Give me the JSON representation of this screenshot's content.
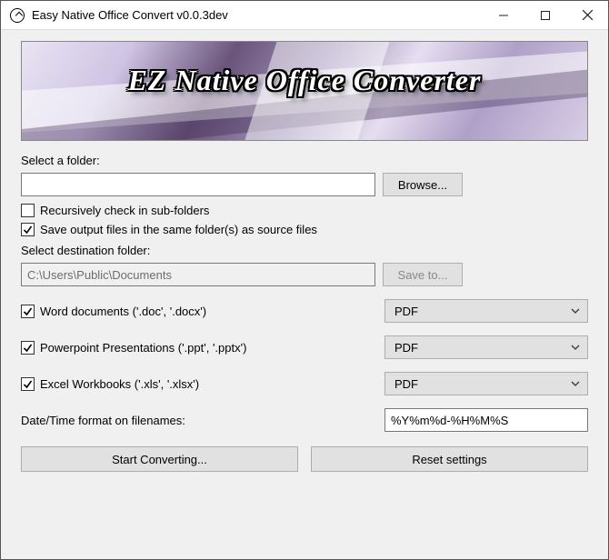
{
  "window": {
    "title": "Easy Native Office Convert v0.0.3dev"
  },
  "banner": {
    "text": "EZ Native Office Converter"
  },
  "labels": {
    "select_folder": "Select a folder:",
    "recursive": "Recursively check in sub-folders",
    "save_same": "Save output files in the same folder(s) as source files",
    "select_dest": "Select destination folder:",
    "datetime": "Date/Time format on filenames:"
  },
  "buttons": {
    "browse": "Browse...",
    "save_to": "Save to...",
    "start": "Start Converting...",
    "reset": "Reset settings"
  },
  "inputs": {
    "source_folder": "",
    "dest_folder": "C:\\Users\\Public\\Documents",
    "datetime_format": "%Y%m%d-%H%M%S"
  },
  "checks": {
    "recursive": false,
    "save_same": true,
    "word": true,
    "ppt": true,
    "xls": true
  },
  "options": {
    "word_label": "Word documents ('.doc', '.docx')",
    "ppt_label": "Powerpoint Presentations ('.ppt', '.pptx')",
    "xls_label": "Excel Workbooks ('.xls', '.xlsx')",
    "word_format": "PDF",
    "ppt_format": "PDF",
    "xls_format": "PDF"
  }
}
